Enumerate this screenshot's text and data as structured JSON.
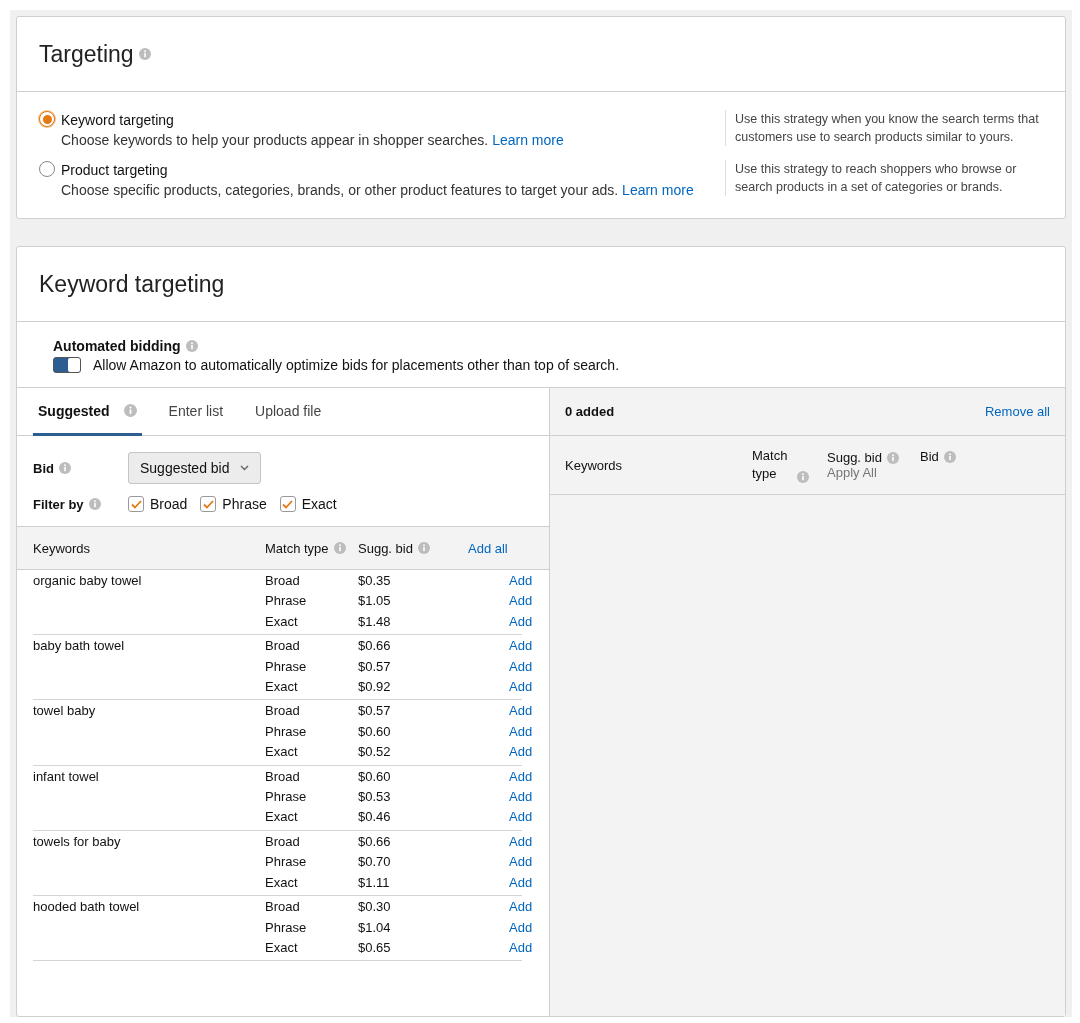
{
  "targeting": {
    "title": "Targeting",
    "options": [
      {
        "label": "Keyword targeting",
        "description": "Choose keywords to help your products appear in shopper searches.",
        "link": "Learn more",
        "selected": true,
        "hint": "Use this strategy when you know the search terms that customers use to search products similar to yours."
      },
      {
        "label": "Product targeting",
        "description": "Choose specific products, categories, brands, or other product features to target your ads.",
        "link": "Learn more",
        "selected": false,
        "hint": "Use this strategy to reach shoppers who browse or search products in a set of categories or brands."
      }
    ]
  },
  "keyword_targeting": {
    "title": "Keyword targeting",
    "automated_bidding": {
      "label": "Automated bidding",
      "toggle_label": "Allow Amazon to automatically optimize bids for placements other than top of search.",
      "on": true
    },
    "tabs": [
      {
        "label": "Suggested",
        "selected": true,
        "info": true
      },
      {
        "label": "Enter list",
        "selected": false,
        "info": false
      },
      {
        "label": "Upload file",
        "selected": false,
        "info": false
      }
    ],
    "bid": {
      "label": "Bid",
      "value": "Suggested bid"
    },
    "filter": {
      "label": "Filter by",
      "options": [
        {
          "label": "Broad",
          "checked": true
        },
        {
          "label": "Phrase",
          "checked": true
        },
        {
          "label": "Exact",
          "checked": true
        }
      ]
    },
    "columns": {
      "keywords": "Keywords",
      "match_type": "Match type",
      "sugg_bid": "Sugg. bid",
      "add_all": "Add all"
    },
    "rows": [
      {
        "keyword": "organic baby towel",
        "matches": [
          {
            "type": "Broad",
            "bid": "$0.35",
            "action": "Add"
          },
          {
            "type": "Phrase",
            "bid": "$1.05",
            "action": "Add"
          },
          {
            "type": "Exact",
            "bid": "$1.48",
            "action": "Add"
          }
        ]
      },
      {
        "keyword": "baby bath towel",
        "matches": [
          {
            "type": "Broad",
            "bid": "$0.66",
            "action": "Add"
          },
          {
            "type": "Phrase",
            "bid": "$0.57",
            "action": "Add"
          },
          {
            "type": "Exact",
            "bid": "$0.92",
            "action": "Add"
          }
        ]
      },
      {
        "keyword": "towel baby",
        "matches": [
          {
            "type": "Broad",
            "bid": "$0.57",
            "action": "Add"
          },
          {
            "type": "Phrase",
            "bid": "$0.60",
            "action": "Add"
          },
          {
            "type": "Exact",
            "bid": "$0.52",
            "action": "Add"
          }
        ]
      },
      {
        "keyword": "infant towel",
        "matches": [
          {
            "type": "Broad",
            "bid": "$0.60",
            "action": "Add"
          },
          {
            "type": "Phrase",
            "bid": "$0.53",
            "action": "Add"
          },
          {
            "type": "Exact",
            "bid": "$0.46",
            "action": "Add"
          }
        ]
      },
      {
        "keyword": "towels for baby",
        "matches": [
          {
            "type": "Broad",
            "bid": "$0.66",
            "action": "Add"
          },
          {
            "type": "Phrase",
            "bid": "$0.70",
            "action": "Add"
          },
          {
            "type": "Exact",
            "bid": "$1.11",
            "action": "Add"
          }
        ]
      },
      {
        "keyword": "hooded bath towel",
        "matches": [
          {
            "type": "Broad",
            "bid": "$0.30",
            "action": "Add"
          },
          {
            "type": "Phrase",
            "bid": "$1.04",
            "action": "Add"
          },
          {
            "type": "Exact",
            "bid": "$0.65",
            "action": "Add"
          }
        ]
      }
    ],
    "added": {
      "count": "0 added",
      "remove_all": "Remove all",
      "columns": {
        "keywords": "Keywords",
        "match_type": "Match type",
        "sugg_bid": "Sugg. bid",
        "apply_all": "Apply All",
        "bid": "Bid"
      }
    }
  }
}
